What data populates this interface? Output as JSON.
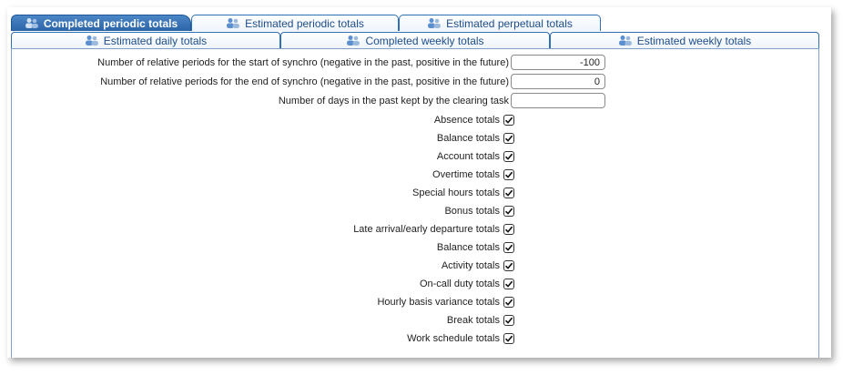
{
  "tabs_row1": [
    {
      "label": "Completed periodic totals",
      "active": true
    },
    {
      "label": "Estimated periodic totals",
      "active": false
    },
    {
      "label": "Estimated perpetual totals",
      "active": false
    }
  ],
  "tabs_row2": [
    {
      "label": "Estimated daily totals"
    },
    {
      "label": "Completed weekly totals"
    },
    {
      "label": "Estimated weekly totals"
    }
  ],
  "fields": [
    {
      "label": "Number of relative periods for the start of synchro (negative in the past, positive in the future)",
      "value": "-100"
    },
    {
      "label": "Number of relative periods for the end of synchro (negative in the past, positive in the future)",
      "value": "0"
    },
    {
      "label": "Number of days in the past kept by the clearing task",
      "value": ""
    }
  ],
  "checkboxes": [
    {
      "label": "Absence totals",
      "checked": true
    },
    {
      "label": "Balance totals",
      "checked": true
    },
    {
      "label": "Account totals",
      "checked": true
    },
    {
      "label": "Overtime totals",
      "checked": true
    },
    {
      "label": "Special hours totals",
      "checked": true
    },
    {
      "label": "Bonus totals",
      "checked": true
    },
    {
      "label": "Late arrival/early departure totals",
      "checked": true
    },
    {
      "label": "Balance totals",
      "checked": true
    },
    {
      "label": "Activity totals",
      "checked": true
    },
    {
      "label": "On-call duty totals",
      "checked": true
    },
    {
      "label": "Hourly basis variance totals",
      "checked": true
    },
    {
      "label": "Break totals",
      "checked": true
    },
    {
      "label": "Work schedule totals",
      "checked": true
    }
  ],
  "colors": {
    "accent": "#2c64a8",
    "border": "#2f6fb3"
  },
  "icons": {
    "tab": "users-group-icon",
    "check": "checkmark-icon"
  }
}
